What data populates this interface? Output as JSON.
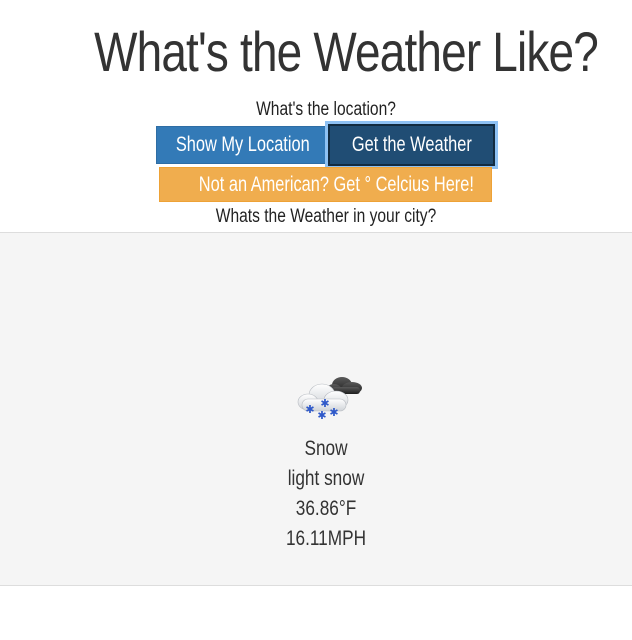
{
  "page": {
    "title": "What's the Weather Like?",
    "subtitle": "What's the location?",
    "prompt": "Whats the Weather in your city?"
  },
  "buttons": {
    "show_location": "Show My Location",
    "get_weather": "Get the Weather",
    "celsius": "Not an American? Get ° Celcius Here!"
  },
  "colors": {
    "primary": "#337ab7",
    "primary_active": "#204d74",
    "warning": "#f0ad4e",
    "panel_bg": "#f5f5f5"
  },
  "weather": {
    "icon": "snow-icon",
    "condition": "Snow",
    "description": "light snow",
    "temperature": "36.86°F",
    "wind": "16.11MPH"
  }
}
